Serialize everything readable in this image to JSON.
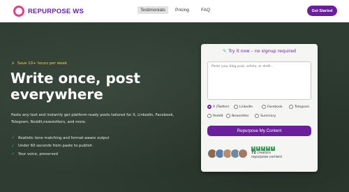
{
  "header": {
    "brand": "REPURPOSE WS",
    "nav": [
      "Testimonials",
      "Pricing",
      "FAQ"
    ],
    "cta_label": "Get Started",
    "brand_color": "#6a1f9b"
  },
  "hero": {
    "badge": "Save 10+ hours per week",
    "headline": "Write once, post everywhere",
    "description": "Paste any text and instantly get platform-ready posts tailored for X, LinkedIn, Facebook, Telegram, Reddit,newsletters, and more.",
    "bullets": [
      "Realistic tone matching and format-aware output",
      "Under 60 seconds from paste to publish",
      "Your voice, preserved"
    ]
  },
  "card": {
    "title": "Try it now – no signup required",
    "placeholder": "Paste your blog post, article, or draft...",
    "platforms": [
      {
        "label": "X (Twitter)",
        "selected": true
      },
      {
        "label": "LinkedIn",
        "selected": false
      },
      {
        "label": "Facebook",
        "selected": false
      },
      {
        "label": "Telegram",
        "selected": false
      },
      {
        "label": "Reddit",
        "selected": false
      },
      {
        "label": "Newsletter",
        "selected": false
      },
      {
        "label": "Summary",
        "selected": false
      }
    ],
    "button_label": "Repurpose My Content",
    "rating_stars": 5,
    "creators_count": "72",
    "creators_text": "creators repurpose content"
  },
  "icons": {
    "logo": "ring-logo-icon",
    "badge": "lightning-bolt-icon",
    "bullet": "check-icon",
    "card_title": "pen-icon",
    "star": "star-icon"
  }
}
